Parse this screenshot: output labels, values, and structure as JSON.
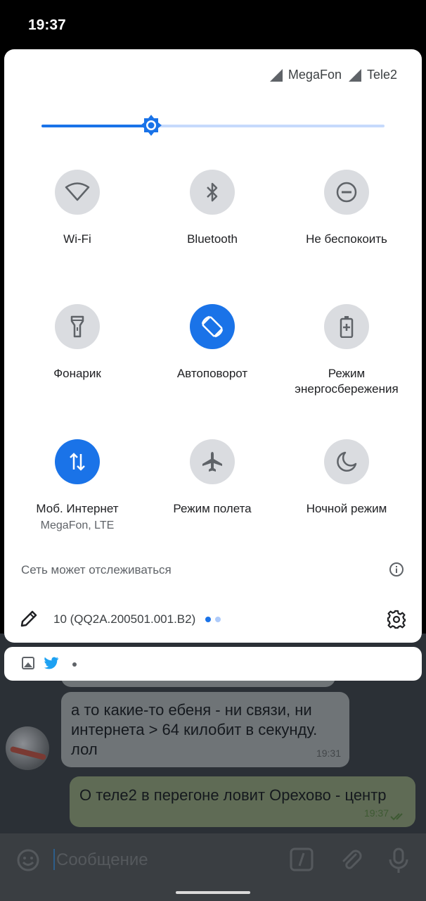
{
  "status_bar": {
    "time": "19:37"
  },
  "operators": [
    {
      "name": "MegaFon",
      "icon": "cell-signal-icon"
    },
    {
      "name": "Tele2",
      "icon": "cell-signal-icon"
    }
  ],
  "brightness": {
    "level": 0.32
  },
  "tiles": [
    {
      "label": "Wi-Fi",
      "sub": "",
      "icon": "wifi-icon",
      "on": false
    },
    {
      "label": "Bluetooth",
      "sub": "",
      "icon": "bluetooth-icon",
      "on": false
    },
    {
      "label": "Не беспокоить",
      "sub": "",
      "icon": "do-not-disturb-icon",
      "on": false
    },
    {
      "label": "Фонарик",
      "sub": "",
      "icon": "flashlight-icon",
      "on": false
    },
    {
      "label": "Автоповорот",
      "sub": "",
      "icon": "auto-rotate-icon",
      "on": true
    },
    {
      "label": "Режим энергосбережения",
      "sub": "",
      "icon": "battery-saver-icon",
      "on": false
    },
    {
      "label": "Моб. Интернет",
      "sub": "MegaFon, LTE",
      "icon": "mobile-data-icon",
      "on": true
    },
    {
      "label": "Режим полета",
      "sub": "",
      "icon": "airplane-icon",
      "on": false
    },
    {
      "label": "Ночной режим",
      "sub": "",
      "icon": "night-mode-icon",
      "on": false
    }
  ],
  "network_notice": "Сеть может отслеживаться",
  "footer": {
    "build": "10 (QQ2A.200501.001.B2)",
    "active_page": 1,
    "pages": 2
  },
  "colors": {
    "accent": "#1a73e8",
    "accent_light": "#c6dafc",
    "tile_off": "#dadce0"
  },
  "notification_icons": [
    "gallery-icon",
    "twitter-icon"
  ],
  "chat": {
    "messages": [
      {
        "text": "а то какие-то ебеня - ни связи, ни интернета > 64 килобит в секунду. лол",
        "time": "19:31",
        "direction": "in"
      },
      {
        "text": "О теле2 в перегоне ловит Орехово - центр",
        "time": "19:37",
        "direction": "out"
      }
    ],
    "input_placeholder": "Сообщение"
  }
}
